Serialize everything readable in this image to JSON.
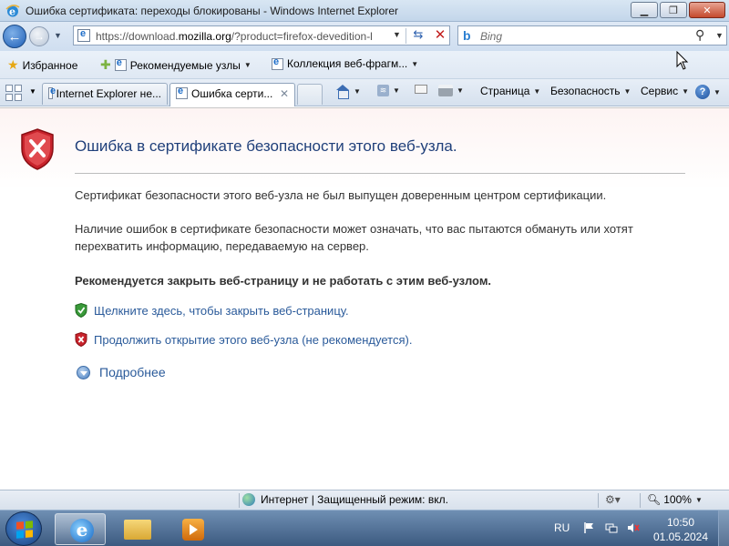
{
  "window": {
    "title": "Ошибка сертификата: переходы блокированы - Windows Internet Explorer"
  },
  "address": {
    "url_prefix": "https://download.",
    "url_domain": "mozilla.org",
    "url_suffix": "/?product=firefox-devedition-l"
  },
  "search": {
    "placeholder": "Bing"
  },
  "favorites": {
    "favorites_label": "Избранное",
    "suggested_sites": "Рекомендуемые узлы",
    "web_slices": "Коллекция веб-фрагм..."
  },
  "tabs": [
    {
      "label": "Internet Explorer не..."
    },
    {
      "label": "Ошибка серти..."
    }
  ],
  "commands": {
    "page": "Страница",
    "safety": "Безопасность",
    "tools": "Сервис"
  },
  "content": {
    "title": "Ошибка в сертификате безопасности этого веб-узла.",
    "para1": "Сертификат безопасности этого веб-узла не был выпущен доверенным центром сертификации.",
    "para2": "Наличие ошибок в сертификате безопасности может означать, что вас пытаются обмануть или хотят перехватить информацию, передаваемую на сервер.",
    "recommend": "Рекомендуется закрыть веб-страницу и не работать с этим веб-узлом.",
    "close_link": "Щелкните здесь, чтобы закрыть веб-страницу.",
    "continue_link": "Продолжить открытие этого веб-узла (не рекомендуется).",
    "more_info": "Подробнее"
  },
  "status": {
    "zone": "Интернет | Защищенный режим: вкл.",
    "zoom": "100%"
  },
  "taskbar": {
    "language": "RU",
    "time": "10:50",
    "date": "01.05.2024"
  },
  "colors": {
    "link": "#2a5a9a",
    "title": "#1f3f7a",
    "error_red": "#c8232c",
    "safe_green": "#3a9a3a"
  }
}
